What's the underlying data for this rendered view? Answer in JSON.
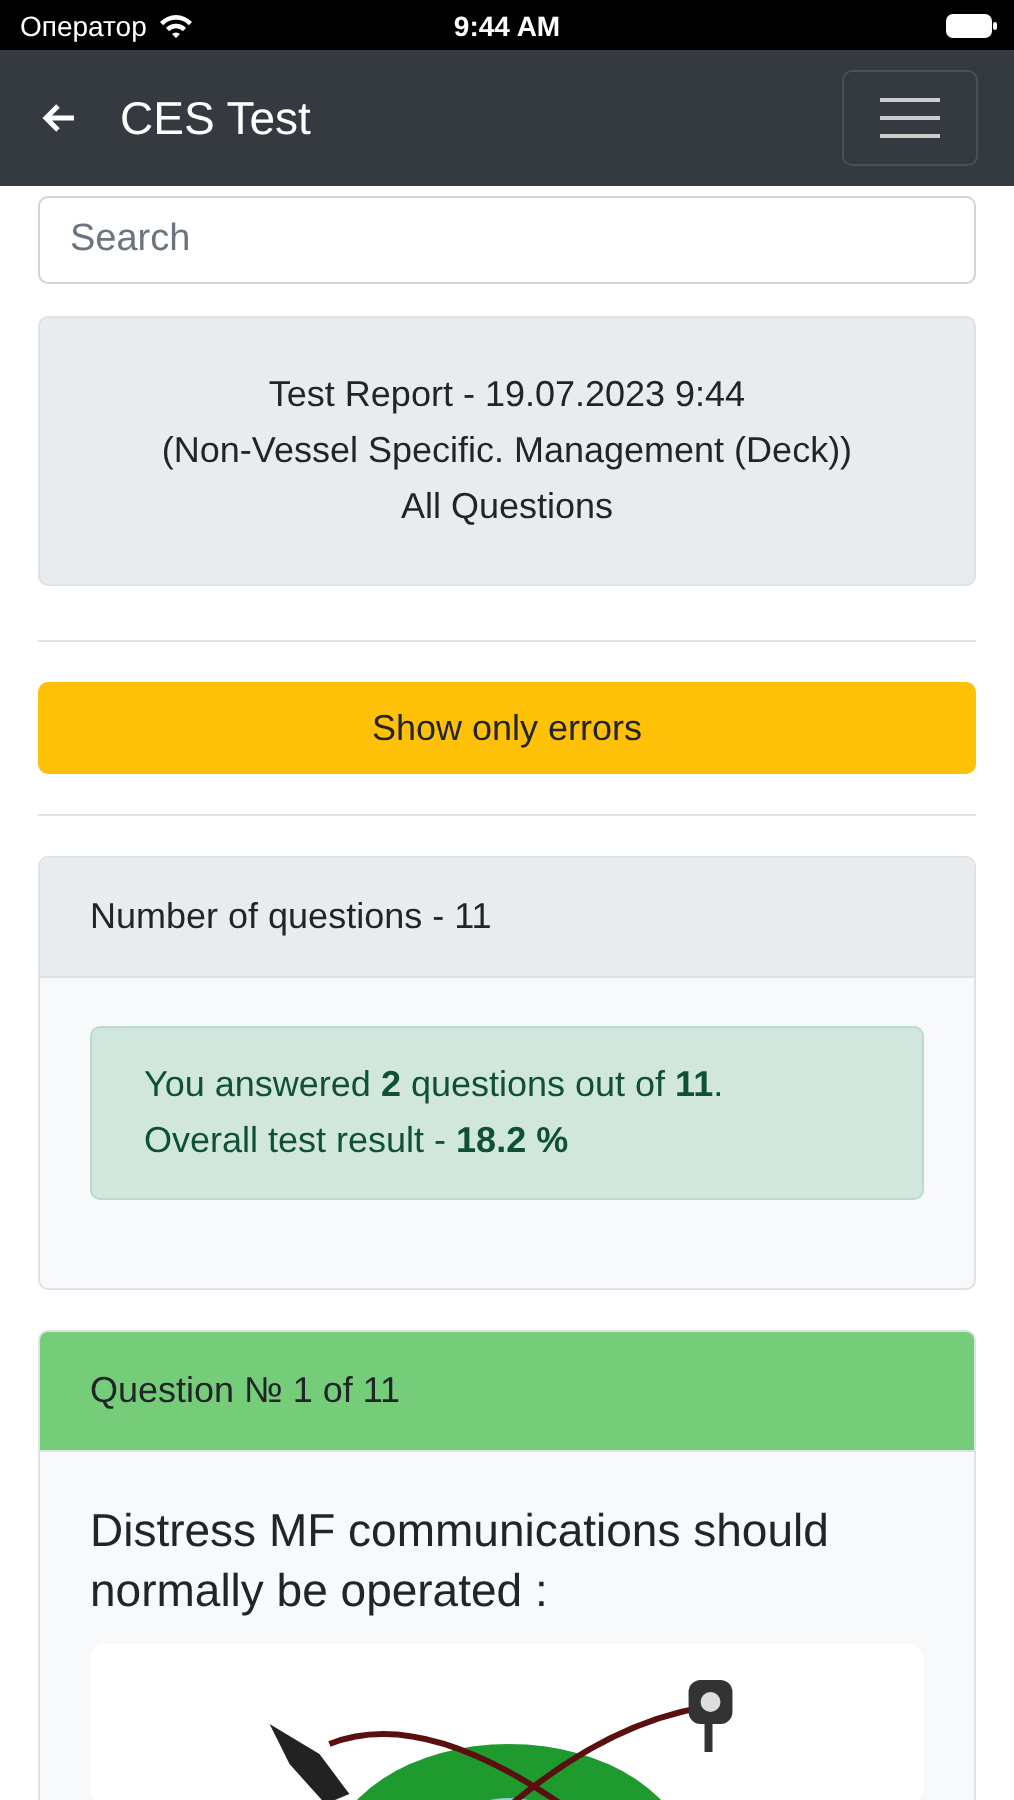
{
  "status_bar": {
    "carrier": "Оператор",
    "time": "9:44 AM"
  },
  "navbar": {
    "title": "CES Test"
  },
  "search": {
    "placeholder": "Search"
  },
  "report": {
    "lines": [
      "Test Report - 19.07.2023 9:44",
      "(Non-Vessel Specific. Management (Deck))",
      "All Questions"
    ]
  },
  "filter_button": {
    "label": "Show only errors"
  },
  "summary": {
    "header": "Number of questions - 11",
    "result_lines": [
      "You answered **2** questions out of **11**.",
      "Overall test result - **18.2 %**"
    ]
  },
  "question": {
    "header": "Question № 1 of 11",
    "text": "Distress MF communications should normally be operated :"
  }
}
